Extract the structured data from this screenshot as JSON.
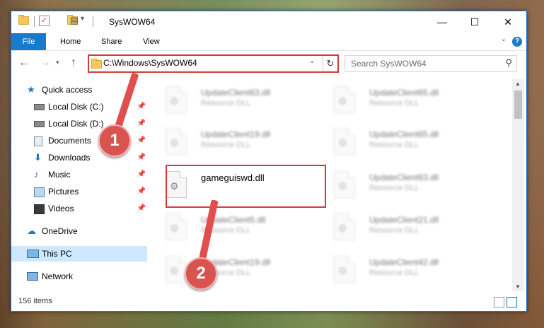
{
  "window": {
    "title": "SysWOW64"
  },
  "ribbon": {
    "file": "File",
    "tabs": [
      "Home",
      "Share",
      "View"
    ]
  },
  "address": {
    "path": "C:\\Windows\\SysWOW64"
  },
  "search": {
    "placeholder": "Search SysWOW64"
  },
  "nav": {
    "items": [
      {
        "label": "Quick access",
        "icon": "star-icon",
        "pinned": false
      },
      {
        "label": "Local Disk (C:)",
        "icon": "drive-icon",
        "pinned": true
      },
      {
        "label": "Local Disk (D:)",
        "icon": "drive-icon",
        "pinned": true
      },
      {
        "label": "Documents",
        "icon": "documents-icon",
        "pinned": true
      },
      {
        "label": "Downloads",
        "icon": "download-icon",
        "pinned": true
      },
      {
        "label": "Music",
        "icon": "music-icon",
        "pinned": true
      },
      {
        "label": "Pictures",
        "icon": "pictures-icon",
        "pinned": true
      },
      {
        "label": "Videos",
        "icon": "videos-icon",
        "pinned": true
      },
      {
        "label": "OneDrive",
        "icon": "cloud-icon",
        "pinned": false
      },
      {
        "label": "This PC",
        "icon": "computer-icon",
        "pinned": false,
        "selected": true
      },
      {
        "label": "Network",
        "icon": "network-icon",
        "pinned": false
      }
    ]
  },
  "files": [
    {
      "name": "UpdateClient63.dll",
      "type": "Resource DLL",
      "blurred": true
    },
    {
      "name": "UpdateClient65.dll",
      "type": "Resource DLL",
      "blurred": true
    },
    {
      "name": "UpdateClient19.dll",
      "type": "Resource DLL",
      "blurred": true
    },
    {
      "name": "UpdateClient65.dll",
      "type": "Resource DLL",
      "blurred": true
    },
    {
      "name": "gameguiswd.dll",
      "type": "",
      "blurred": false
    },
    {
      "name": "UpdateClient63.dll",
      "type": "Resource DLL",
      "blurred": true
    },
    {
      "name": "UpdateClient5.dll",
      "type": "Resource DLL",
      "blurred": true
    },
    {
      "name": "UpdateClient21.dll",
      "type": "Resource DLL",
      "blurred": true
    },
    {
      "name": "UpdateClient19.dll",
      "type": "Resource DLL",
      "blurred": true
    },
    {
      "name": "UpdateClient42.dll",
      "type": "Resource DLL",
      "blurred": true
    }
  ],
  "status": {
    "items": "156 items"
  },
  "annotations": {
    "step1": "1",
    "step2": "2"
  },
  "colors": {
    "accent": "#1979ca",
    "highlight": "#d43a3a",
    "selected": "#cde8ff"
  }
}
